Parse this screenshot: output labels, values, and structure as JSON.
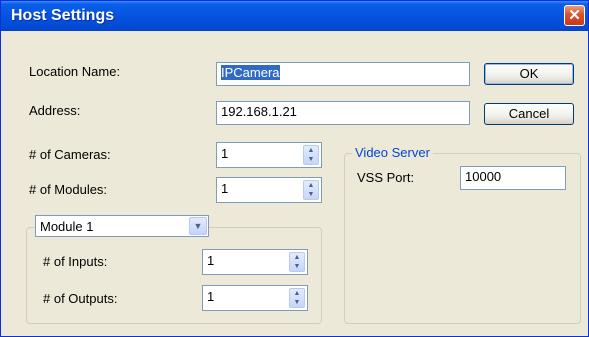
{
  "window": {
    "title": "Host Settings",
    "close_symbol": "✕"
  },
  "fields": {
    "location_name": {
      "label": "Location Name:",
      "value": "IPCamera"
    },
    "address": {
      "label": "Address:",
      "value": "192.168.1.21"
    },
    "cameras": {
      "label": "# of Cameras:",
      "value": "1"
    },
    "modules": {
      "label": "# of Modules:",
      "value": "1"
    }
  },
  "buttons": {
    "ok": "OK",
    "cancel": "Cancel"
  },
  "module_group": {
    "selected_module": "Module 1",
    "inputs": {
      "label": "# of Inputs:",
      "value": "1"
    },
    "outputs": {
      "label": "# of Outputs:",
      "value": "1"
    }
  },
  "video_server": {
    "legend": "Video Server",
    "vss_port": {
      "label": "VSS Port:",
      "value": "10000"
    }
  },
  "spin": {
    "up": "▲",
    "down": "▼"
  },
  "combo_arrow": "▼"
}
